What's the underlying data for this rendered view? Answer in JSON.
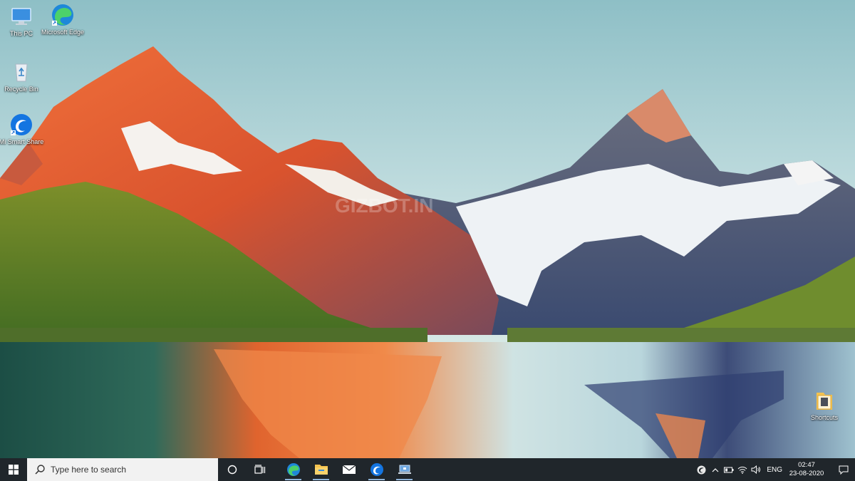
{
  "desktop": {
    "icons": [
      {
        "label": "This PC",
        "icon": "this-pc-icon"
      },
      {
        "label": "Microsoft Edge",
        "icon": "edge-icon"
      },
      {
        "label": "Recycle Bin",
        "icon": "recycle-bin-icon"
      },
      {
        "label": "Mi Smart Share",
        "icon": "mi-smart-share-icon"
      },
      {
        "label": "Shortcuts",
        "icon": "shortcuts-folder-icon"
      }
    ],
    "wallpaper_watermark": "GIZBOT.IN"
  },
  "taskbar": {
    "search_placeholder": "Type here to search",
    "pinned": [
      "edge-icon",
      "file-explorer-icon",
      "mail-icon",
      "mi-smart-share-icon",
      "network-share-icon"
    ],
    "tray": {
      "language": "ENG",
      "time": "02:47",
      "date": "23-08-2020"
    }
  },
  "colors": {
    "taskbar_bg": "#20262b",
    "search_bg": "#f2f2f2",
    "accent": "#0078d7"
  }
}
